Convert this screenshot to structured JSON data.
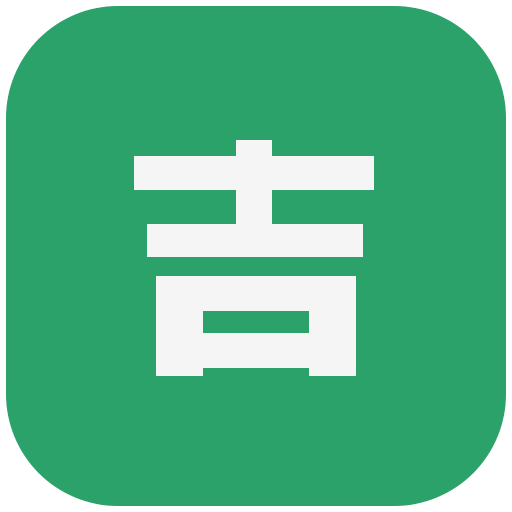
{
  "app_icon": {
    "glyph": "吉",
    "icon_name": "ji-character-icon",
    "background_color": "#2aa26a",
    "glyph_color": "#f5f5f5"
  }
}
